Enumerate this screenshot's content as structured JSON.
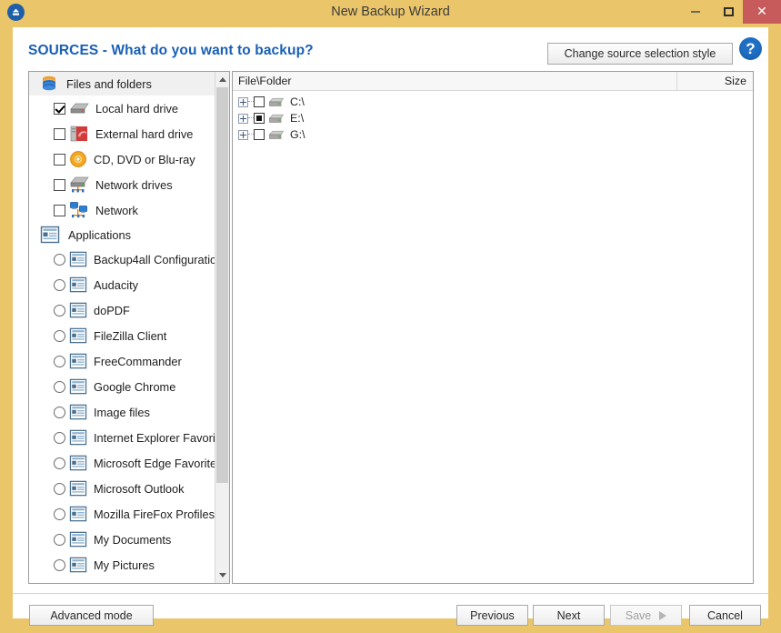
{
  "window": {
    "title": "New Backup Wizard",
    "app_icon": "eject-disc-icon",
    "controls": {
      "minimize": "minimize-icon",
      "maximize": "maximize-icon",
      "close": "✕"
    },
    "titlebar_color": "#eac56a",
    "close_button_color": "#c75b5b"
  },
  "header": {
    "page_title": "SOURCES - What do you want to backup?",
    "page_title_color": "#1a5fb4",
    "change_style_label": "Change source selection style",
    "help_label": "?"
  },
  "sources_panel": {
    "groups": [
      {
        "label": "Files and folders",
        "icon": "database-stack-icon",
        "control": "checkbox",
        "items": [
          {
            "label": "Local hard drive",
            "icon": "hard-drive-icon",
            "checked": true
          },
          {
            "label": "External hard drive",
            "icon": "external-drive-icon",
            "checked": false
          },
          {
            "label": "CD, DVD or Blu-ray",
            "icon": "optical-disc-icon",
            "checked": false
          },
          {
            "label": "Network drives",
            "icon": "network-drive-icon",
            "checked": false
          },
          {
            "label": "Network",
            "icon": "network-icon",
            "checked": false
          }
        ]
      },
      {
        "label": "Applications",
        "icon": "application-document-icon",
        "control": "radio",
        "items": [
          {
            "label": "Backup4all Configuratio",
            "icon": "application-document-icon",
            "checked": false
          },
          {
            "label": "Audacity",
            "icon": "application-document-icon",
            "checked": false
          },
          {
            "label": "doPDF",
            "icon": "application-document-icon",
            "checked": false
          },
          {
            "label": "FileZilla Client",
            "icon": "application-document-icon",
            "checked": false
          },
          {
            "label": "FreeCommander",
            "icon": "application-document-icon",
            "checked": false
          },
          {
            "label": "Google Chrome",
            "icon": "application-document-icon",
            "checked": false
          },
          {
            "label": "Image files",
            "icon": "application-document-icon",
            "checked": false
          },
          {
            "label": "Internet Explorer Favorite",
            "icon": "application-document-icon",
            "checked": false
          },
          {
            "label": "Microsoft Edge Favorites",
            "icon": "application-document-icon",
            "checked": false
          },
          {
            "label": "Microsoft Outlook",
            "icon": "application-document-icon",
            "checked": false
          },
          {
            "label": "Mozilla FireFox Profiles",
            "icon": "application-document-icon",
            "checked": false
          },
          {
            "label": "My Documents",
            "icon": "application-document-icon",
            "checked": false
          },
          {
            "label": "My Pictures",
            "icon": "application-document-icon",
            "checked": false
          }
        ]
      }
    ],
    "scrollbar": {
      "up": "scroll-up-arrow",
      "down": "scroll-down-arrow"
    }
  },
  "file_tree": {
    "columns": {
      "file": "File\\Folder",
      "size": "Size"
    },
    "rows": [
      {
        "label": "C:\\",
        "state": "unchecked",
        "icon": "drive-icon",
        "expandable": true,
        "size": ""
      },
      {
        "label": "E:\\",
        "state": "partial",
        "icon": "drive-icon",
        "expandable": true,
        "size": ""
      },
      {
        "label": "G:\\",
        "state": "unchecked",
        "icon": "drive-icon",
        "expandable": true,
        "size": ""
      }
    ]
  },
  "footer": {
    "advanced_label": "Advanced mode",
    "previous_label": "Previous",
    "next_label": "Next",
    "save_label": "Save",
    "cancel_label": "Cancel",
    "save_disabled": true
  }
}
